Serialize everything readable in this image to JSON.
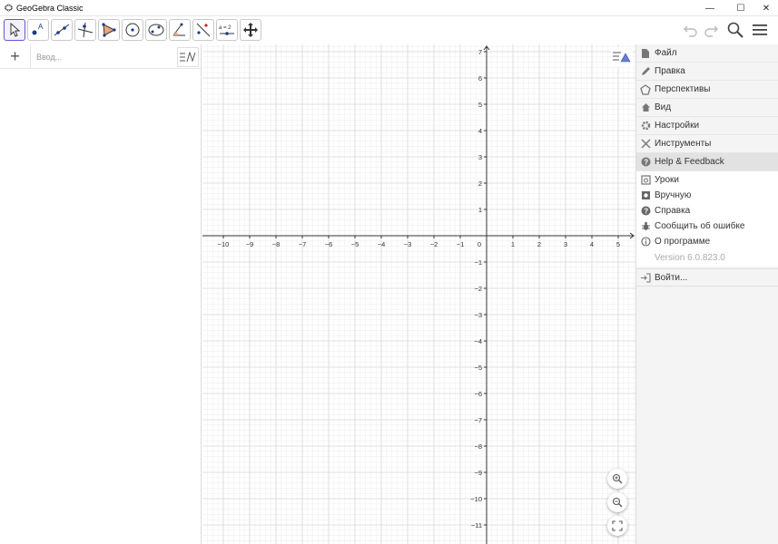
{
  "window": {
    "title": "GeoGebra Classic",
    "minimize": "—",
    "maximize": "☐",
    "close": "✕"
  },
  "toolbar": {
    "tools": [
      {
        "name": "move-tool",
        "icon": "pointer-icon"
      },
      {
        "name": "point-tool",
        "icon": "point-icon"
      },
      {
        "name": "line-tool",
        "icon": "line-icon"
      },
      {
        "name": "perpendicular-tool",
        "icon": "perpendicular-icon"
      },
      {
        "name": "polygon-tool",
        "icon": "polygon-icon"
      },
      {
        "name": "circle-tool",
        "icon": "circle-icon"
      },
      {
        "name": "conic-tool",
        "icon": "ellipse-icon"
      },
      {
        "name": "angle-tool",
        "icon": "angle-icon"
      },
      {
        "name": "reflect-tool",
        "icon": "reflect-icon"
      },
      {
        "name": "slider-tool",
        "icon": "slider-icon",
        "text": "a = 2"
      },
      {
        "name": "move-view-tool",
        "icon": "move-view-icon"
      }
    ]
  },
  "algebra": {
    "plus": "+",
    "input_placeholder": "Ввод..."
  },
  "graphics": {
    "x_ticks": [
      "−10",
      "−9",
      "−8",
      "−7",
      "−6",
      "−5",
      "−4",
      "−3",
      "−2",
      "−1",
      "0",
      "1",
      "2",
      "3",
      "4",
      "5"
    ],
    "y_ticks_pos": [
      "7",
      "6",
      "5",
      "4",
      "3",
      "2",
      "1"
    ],
    "y_ticks_neg": [
      "−1",
      "−2",
      "−3",
      "−4",
      "−5",
      "−6",
      "−7",
      "−8",
      "−9",
      "−10",
      "−11"
    ]
  },
  "menu": {
    "items": [
      {
        "label": "Файл",
        "icon": "file-icon"
      },
      {
        "label": "Правка",
        "icon": "pencil-icon"
      },
      {
        "label": "Перспективы",
        "icon": "perspectives-icon"
      },
      {
        "label": "Вид",
        "icon": "home-icon"
      },
      {
        "label": "Настройки",
        "icon": "gear-icon"
      },
      {
        "label": "Инструменты",
        "icon": "tools-icon"
      },
      {
        "label": "Help & Feedback",
        "icon": "help-icon"
      }
    ],
    "help_sub": [
      {
        "label": "Уроки",
        "icon": "tutorials-icon"
      },
      {
        "label": "Вручную",
        "icon": "manual-icon"
      },
      {
        "label": "Справка",
        "icon": "question-icon"
      },
      {
        "label": "Сообщить об ошибке",
        "icon": "bug-icon"
      },
      {
        "label": "О программе",
        "icon": "info-icon"
      }
    ],
    "version": "Version 6.0.823.0",
    "login": "Войти..."
  },
  "colors": {
    "accent": "#6557d2",
    "point": "#1565c0",
    "grid_major": "#d9d9d9",
    "grid_minor": "#efefef"
  }
}
